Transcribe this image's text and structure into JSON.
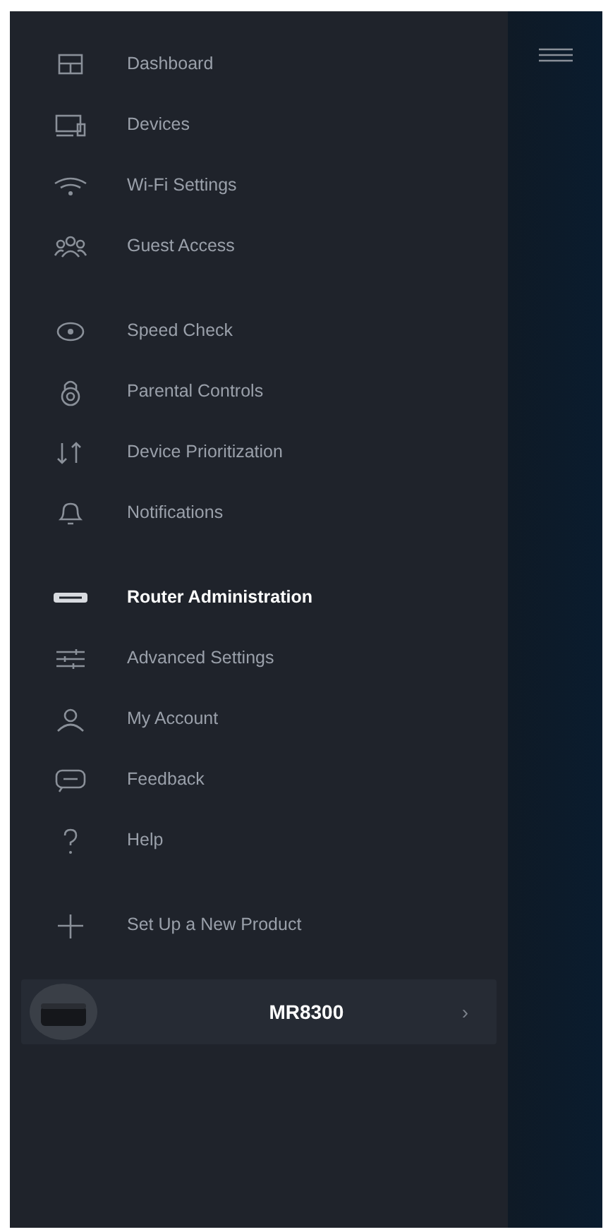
{
  "menu_groups": [
    [
      {
        "label": "Dashboard",
        "selected": false
      },
      {
        "label": "Devices",
        "selected": false
      },
      {
        "label": "Wi-Fi Settings",
        "selected": false
      },
      {
        "label": "Guest Access",
        "selected": false
      }
    ],
    [
      {
        "label": "Speed Check",
        "selected": false
      },
      {
        "label": "Parental Controls",
        "selected": false
      },
      {
        "label": "Device Prioritization",
        "selected": false
      },
      {
        "label": "Notifications",
        "selected": false
      }
    ],
    [
      {
        "label": "Router Administration",
        "selected": true
      },
      {
        "label": "Advanced Settings",
        "selected": false
      },
      {
        "label": "My Account",
        "selected": false
      },
      {
        "label": "Feedback",
        "selected": false
      },
      {
        "label": "Help",
        "selected": false
      }
    ],
    [
      {
        "label": "Set Up a New Product",
        "selected": false
      }
    ]
  ],
  "router": {
    "name": "MR8300",
    "chevron": "›"
  }
}
